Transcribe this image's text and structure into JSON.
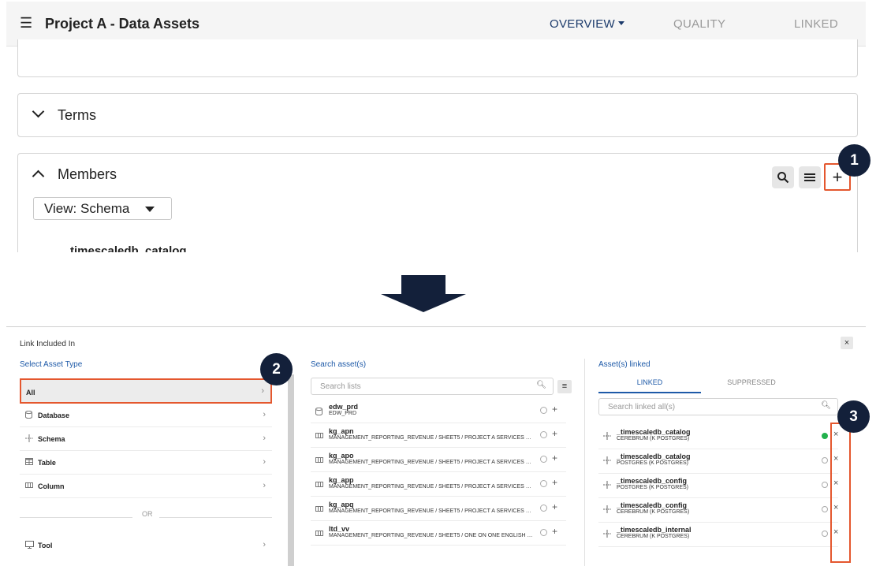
{
  "header": {
    "menu_icon": "menu-icon",
    "title": "Project A - Data Assets",
    "tabs": [
      {
        "label": "OVERVIEW",
        "active": true
      },
      {
        "label": "QUALITY",
        "active": false
      },
      {
        "label": "LINKED",
        "active": false
      }
    ]
  },
  "sections": {
    "terms": "Terms",
    "members": "Members"
  },
  "members_toolbar": {
    "search_icon": "search-icon",
    "list_icon": "list-icon",
    "add_label": "+"
  },
  "view_select": {
    "value": "View: Schema"
  },
  "members_first_item": "timescaledb_catalog",
  "badges": [
    "1",
    "2",
    "3"
  ],
  "dialog": {
    "title": "Link Included In",
    "close_label": "×",
    "col1_header": "Select Asset Type",
    "col2_header": "Search asset(s)",
    "col3_header": "Asset(s) linked",
    "asset_types": [
      {
        "label": "All",
        "icon": ""
      },
      {
        "label": "Database",
        "icon": "database-icon"
      },
      {
        "label": "Schema",
        "icon": "schema-icon"
      },
      {
        "label": "Table",
        "icon": "table-icon"
      },
      {
        "label": "Column",
        "icon": "column-icon"
      }
    ],
    "or_label": "OR",
    "tool_label": "Tool",
    "search_lists_placeholder": "Search lists",
    "assets": [
      {
        "name": "edw_prd",
        "path": "EDW_PRD",
        "icon": "database-icon"
      },
      {
        "name": "kg_apn",
        "path": "MANAGEMENT_REPORTING_REVENUE / SHEET5 / PROJECT A SERVICES GMB...",
        "icon": "column-icon"
      },
      {
        "name": "kg_apo",
        "path": "MANAGEMENT_REPORTING_REVENUE / SHEET5 / PROJECT A SERVICES GMB...",
        "icon": "column-icon"
      },
      {
        "name": "kg_app",
        "path": "MANAGEMENT_REPORTING_REVENUE / SHEET5 / PROJECT A SERVICES GMB...",
        "icon": "column-icon"
      },
      {
        "name": "kg_apq",
        "path": "MANAGEMENT_REPORTING_REVENUE / SHEET5 / PROJECT A SERVICES GMB...",
        "icon": "column-icon"
      },
      {
        "name": "ltd_vv",
        "path": "MANAGEMENT_REPORTING_REVENUE / SHEET5 / ONE ON ONE ENGLISH CO (...",
        "icon": "column-icon"
      }
    ],
    "linked_tabs": [
      "LINKED",
      "SUPPRESSED"
    ],
    "search_linked_placeholder": "Search linked all(s)",
    "linked": [
      {
        "name": "_timescaledb_catalog",
        "path": "CEREBRUM (K POSTGRES)",
        "status": "ok"
      },
      {
        "name": "_timescaledb_catalog",
        "path": "POSTGRES (K POSTGRES)",
        "status": "none"
      },
      {
        "name": "_timescaledb_config",
        "path": "POSTGRES (K POSTGRES)",
        "status": "none"
      },
      {
        "name": "_timescaledb_config",
        "path": "CEREBRUM (K POSTGRES)",
        "status": "none"
      },
      {
        "name": "_timescaledb_internal",
        "path": "CEREBRUM (K POSTGRES)",
        "status": "none"
      }
    ]
  },
  "colors": {
    "navy": "#1b3a6b",
    "accent_blue": "#1e5aa8",
    "highlight_orange": "#e4572e",
    "badge": "#13203a",
    "ok_green": "#22b14c"
  }
}
